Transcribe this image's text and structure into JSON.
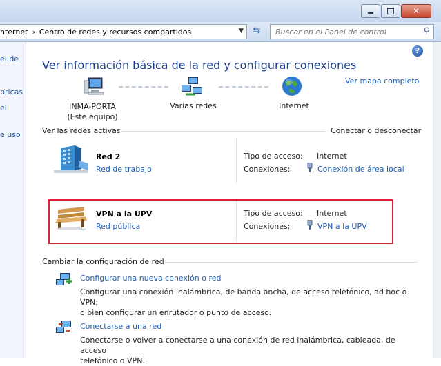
{
  "window": {
    "minimize_label": "minimize",
    "maximize_label": "maximize",
    "close_label": "close"
  },
  "address": {
    "crumb_1": "nternet",
    "crumb_2": "Centro de redes y recursos compartidos",
    "search_placeholder": "Buscar en el Panel de control"
  },
  "left_pane": {
    "items": [
      "el de",
      "bricas",
      "el",
      "e uso"
    ]
  },
  "main": {
    "help": "?",
    "title": "Ver información básica de la red y configurar conexiones",
    "map_link": "Ver mapa completo",
    "nodes": {
      "computer_line1": "INMA-PORTA",
      "computer_line2": "(Este equipo)",
      "middle": "Varias redes",
      "internet": "Internet"
    },
    "active_networks": {
      "heading": "Ver las redes activas",
      "connect_link": "Conectar o desconectar",
      "networks": [
        {
          "name": "Red  2",
          "type": "Red de trabajo",
          "access_label": "Tipo de acceso:",
          "access_value": "Internet",
          "conn_label": "Conexiones:",
          "conn_value": "Conexión de área local"
        },
        {
          "name": "VPN a la UPV",
          "type": "Red pública",
          "access_label": "Tipo de acceso:",
          "access_value": "Internet",
          "conn_label": "Conexiones:",
          "conn_value": "VPN a la UPV"
        }
      ]
    },
    "change_settings": {
      "heading": "Cambiar la configuración de red",
      "tasks": [
        {
          "title": "Configurar una nueva conexión o red",
          "desc_line1": "Configurar una conexión inalámbrica, de banda ancha, de acceso telefónico, ad hoc o VPN;",
          "desc_line2": "o bien configurar un enrutador o punto de acceso."
        },
        {
          "title": "Conectarse a una red",
          "desc_line1": "Conectarse o volver a conectarse a una conexión de red inalámbrica, cableada, de acceso",
          "desc_line2": "telefónico o VPN."
        }
      ]
    }
  },
  "colors": {
    "link": "#1e5fb4",
    "title": "#1e3f8a",
    "highlight_box": "#d9262d"
  }
}
